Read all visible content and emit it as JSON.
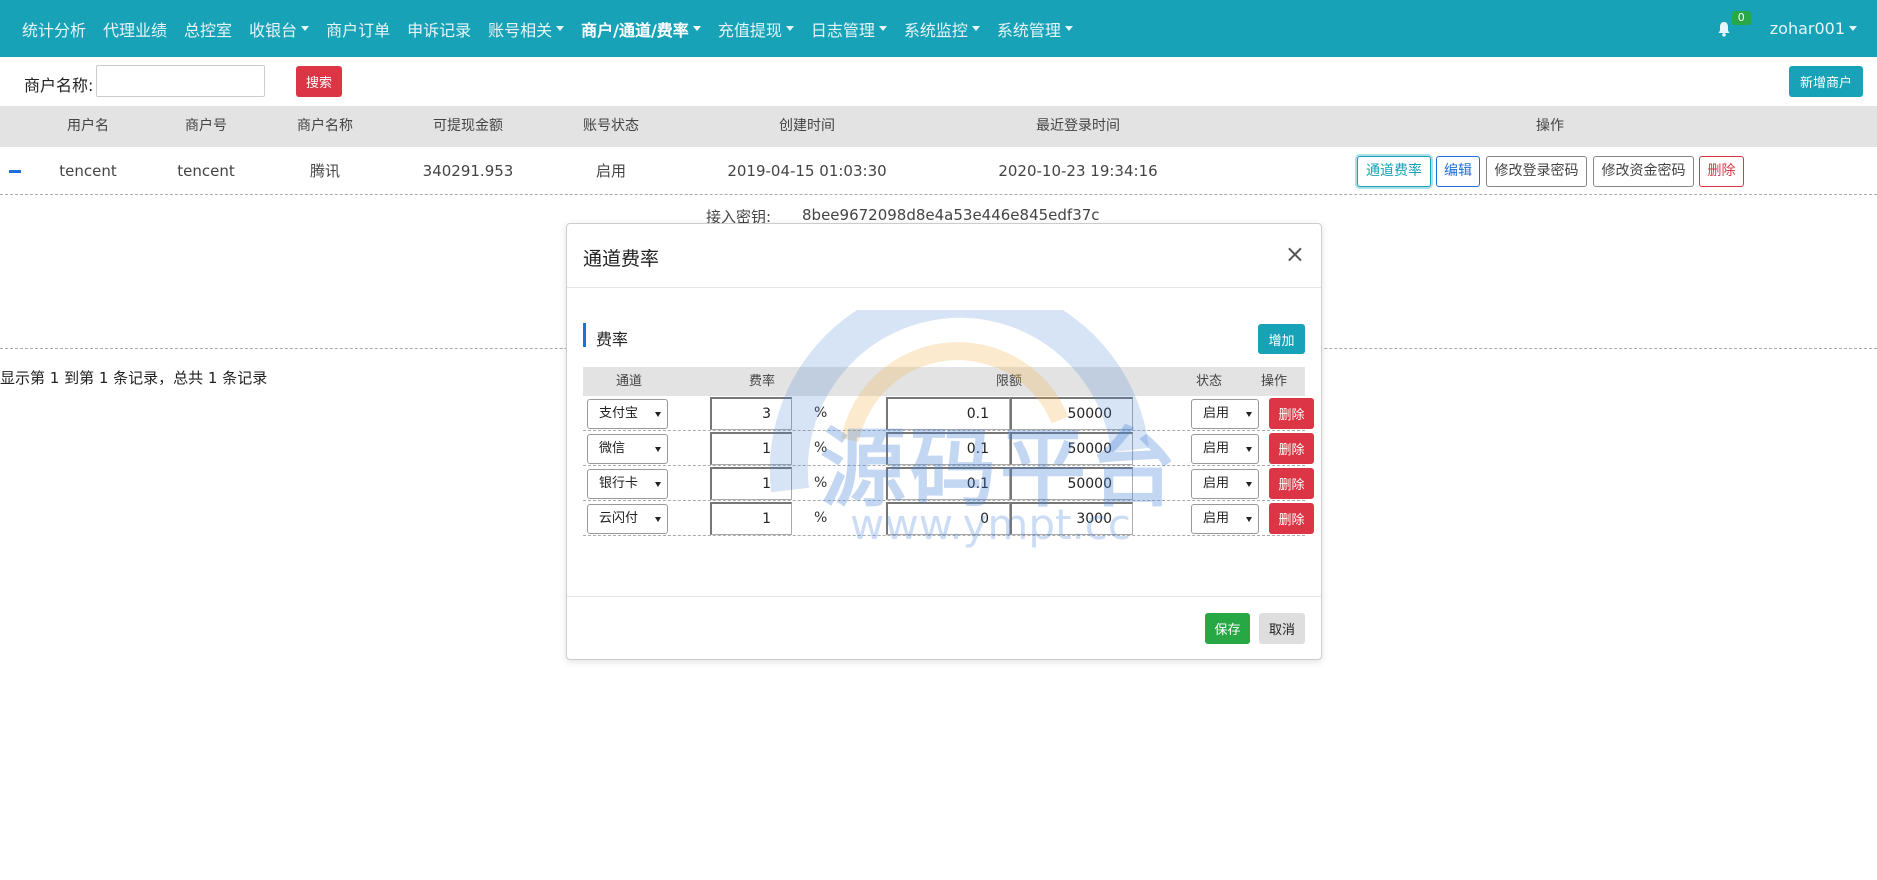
{
  "nav": {
    "items": [
      {
        "label": "统计分析",
        "dropdown": false,
        "active": false
      },
      {
        "label": "代理业绩",
        "dropdown": false,
        "active": false
      },
      {
        "label": "总控室",
        "dropdown": false,
        "active": false
      },
      {
        "label": "收银台",
        "dropdown": true,
        "active": false
      },
      {
        "label": "商户订单",
        "dropdown": false,
        "active": false
      },
      {
        "label": "申诉记录",
        "dropdown": false,
        "active": false
      },
      {
        "label": "账号相关",
        "dropdown": true,
        "active": false
      },
      {
        "label": "商户/通道/费率",
        "dropdown": true,
        "active": true
      },
      {
        "label": "充值提现",
        "dropdown": true,
        "active": false
      },
      {
        "label": "日志管理",
        "dropdown": true,
        "active": false
      },
      {
        "label": "系统监控",
        "dropdown": true,
        "active": false
      },
      {
        "label": "系统管理",
        "dropdown": true,
        "active": false
      }
    ],
    "notification_count": "0",
    "username": "zohar001",
    "bell_icon": "bell-icon"
  },
  "search": {
    "label": "商户名称:",
    "value": "",
    "button_label": "搜索",
    "add_button_label": "新增商户"
  },
  "table": {
    "columns": [
      "用户名",
      "商户号",
      "商户名称",
      "可提现金额",
      "账号状态",
      "创建时间",
      "最近登录时间",
      "操作"
    ],
    "rows": [
      {
        "username": "tencent",
        "merchant_no": "tencent",
        "merchant_name": "腾讯",
        "withdrawable": "340291.953",
        "status": "启用",
        "created_at": "2019-04-15 01:03:30",
        "last_login": "2020-10-23 19:34:16",
        "actions": [
          "通道费率",
          "编辑",
          "修改登录密码",
          "修改资金密码",
          "删除"
        ]
      }
    ],
    "detail": {
      "label": "接入密钥:",
      "value": "8bee9672098d8e4a53e446e845edf37c"
    },
    "pager_info": "显示第 1 到第 1 条记录，总共 1 条记录"
  },
  "modal": {
    "title": "通道费率",
    "close_symbol": "×",
    "section_title": "费率",
    "add_button_label": "增加",
    "columns": [
      "通道",
      "费率",
      "限额",
      "状态",
      "操作"
    ],
    "percent_symbol": "%",
    "rows": [
      {
        "channel": "支付宝",
        "rate": "3",
        "min": "0.1",
        "max": "50000",
        "status": "启用",
        "delete_label": "删除"
      },
      {
        "channel": "微信",
        "rate": "1",
        "min": "0.1",
        "max": "50000",
        "status": "启用",
        "delete_label": "删除"
      },
      {
        "channel": "银行卡",
        "rate": "1",
        "min": "0.1",
        "max": "50000",
        "status": "启用",
        "delete_label": "删除"
      },
      {
        "channel": "云闪付",
        "rate": "1",
        "min": "0",
        "max": "3000",
        "status": "启用",
        "delete_label": "删除"
      }
    ],
    "save_label": "保存",
    "cancel_label": "取消"
  },
  "watermark": {
    "text": "源码平台",
    "url": "www.ympt.cc"
  },
  "colors": {
    "primary": "#17a2b8",
    "danger": "#dc3545",
    "success": "#28a745",
    "link": "#1e6fd9"
  }
}
